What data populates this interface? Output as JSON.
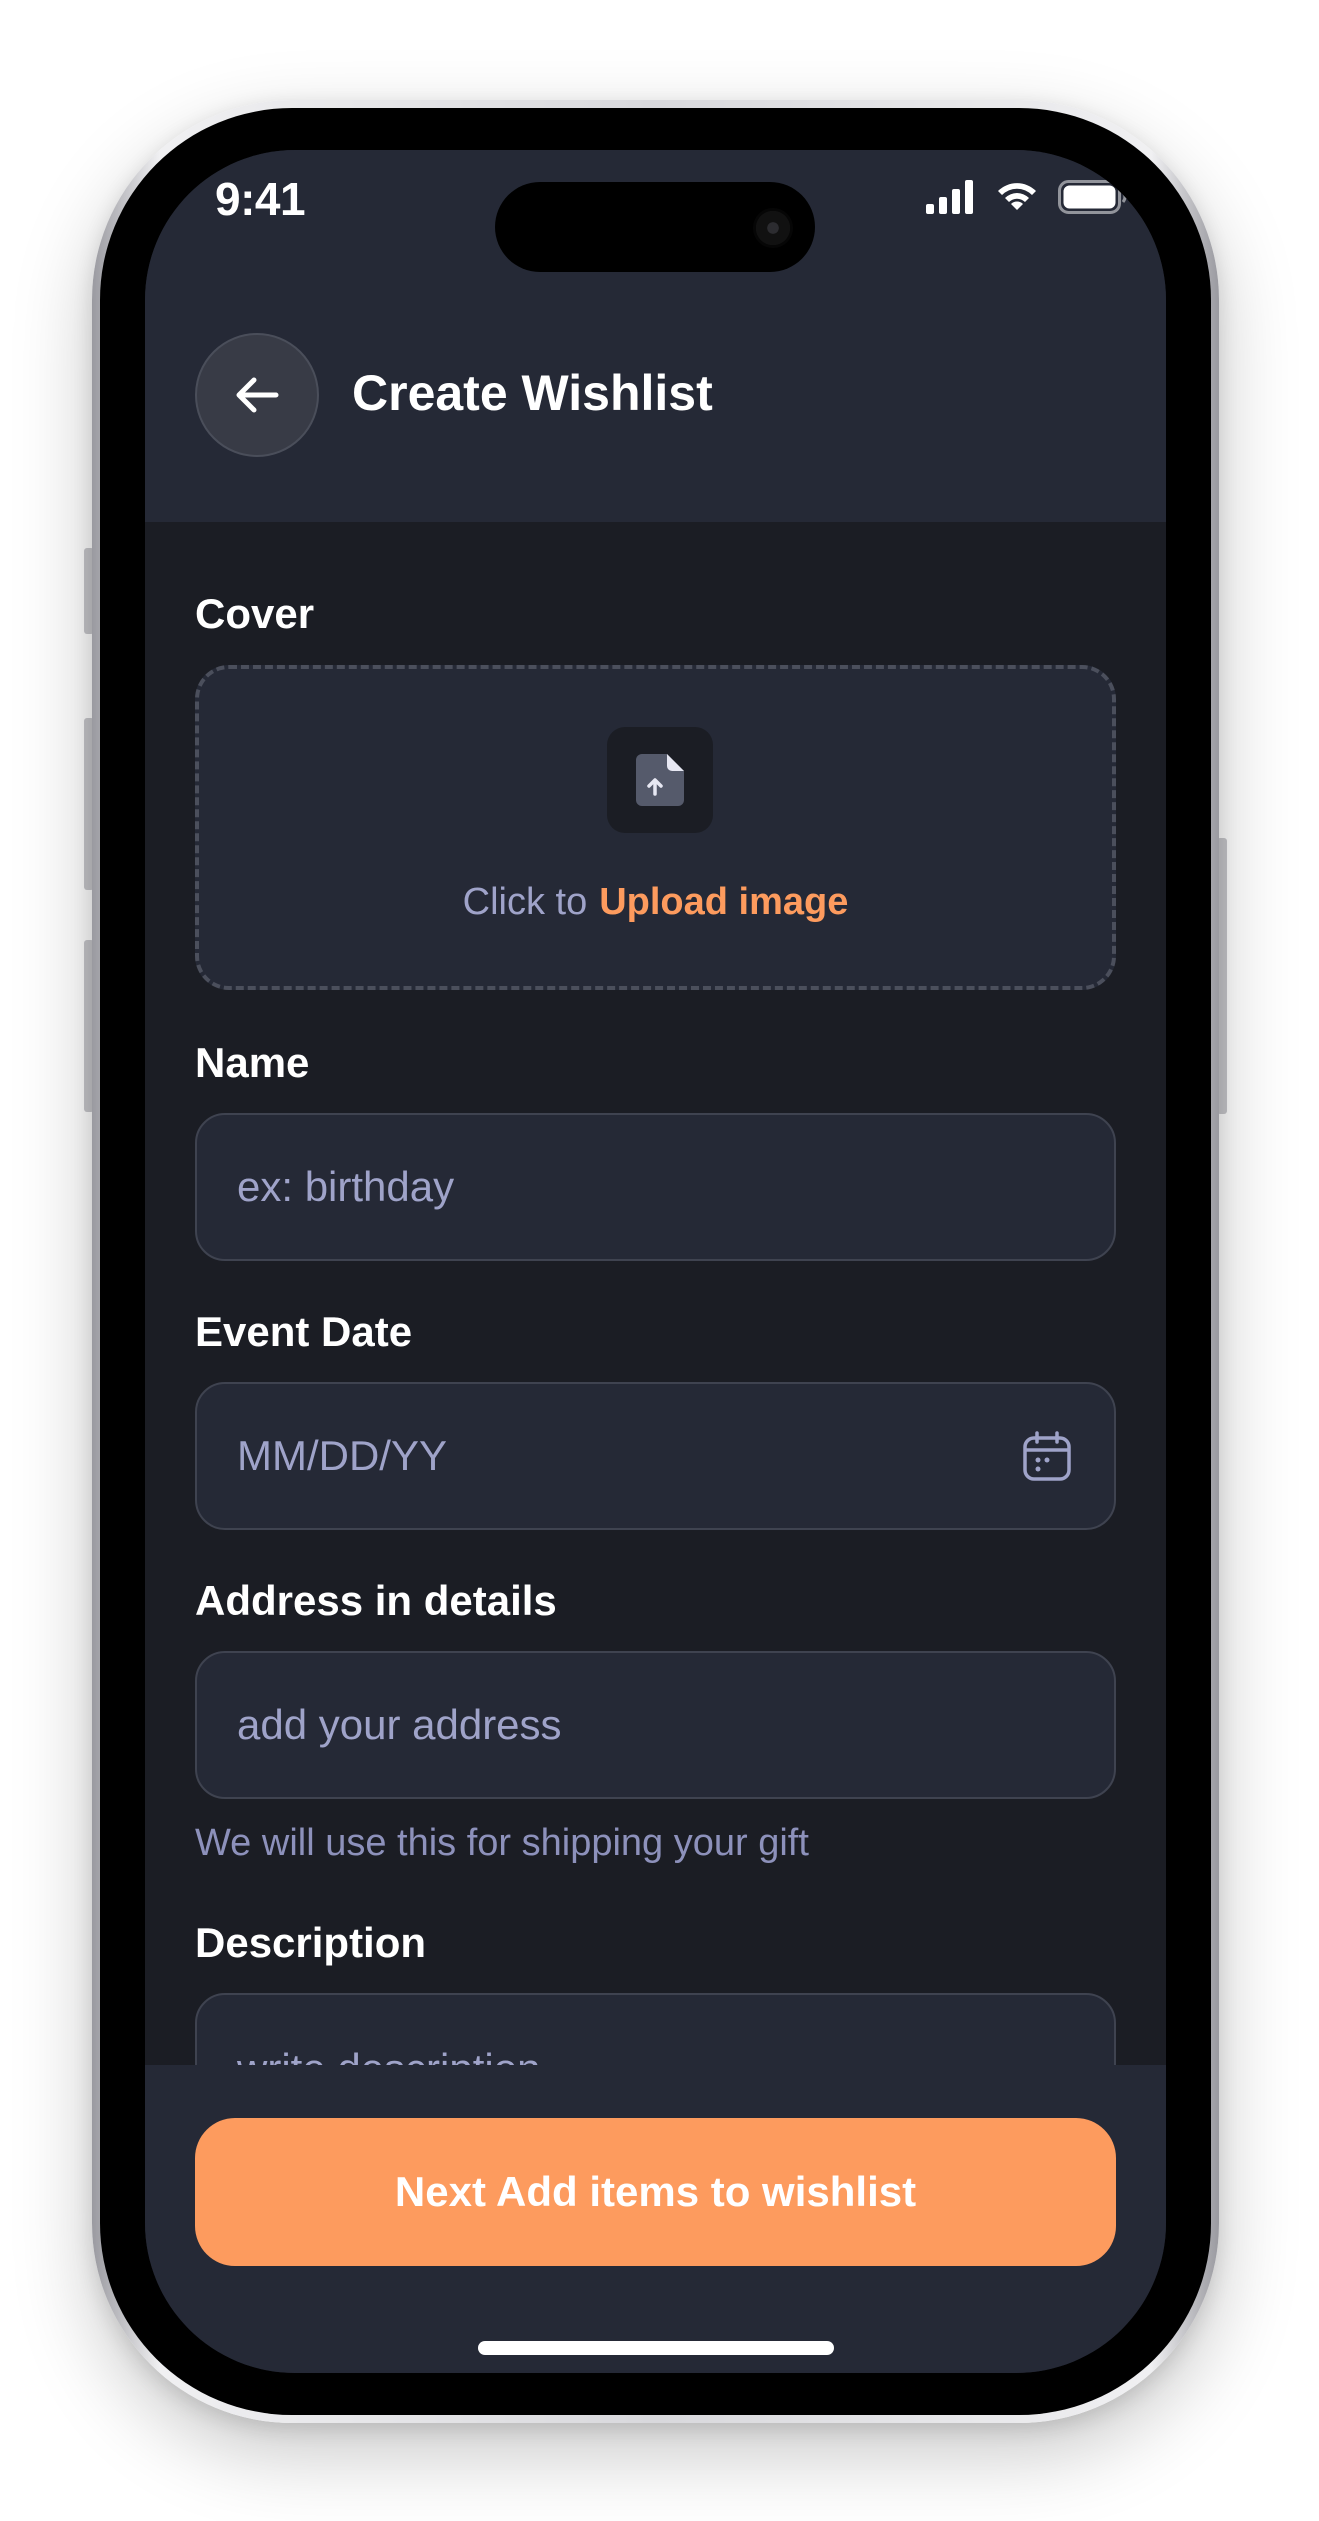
{
  "status_bar": {
    "time": "9:41",
    "icons": [
      "signal-icon",
      "wifi-icon",
      "battery-icon"
    ]
  },
  "header": {
    "back_icon": "arrow-left-icon",
    "title": "Create Wishlist"
  },
  "cover": {
    "label": "Cover",
    "icon": "file-upload-icon",
    "prefix_text": "Click to",
    "action_text": "Upload image"
  },
  "name": {
    "label": "Name",
    "placeholder": "ex: birthday"
  },
  "event_date": {
    "label": "Event Date",
    "placeholder": "MM/DD/YY",
    "icon": "calendar-icon"
  },
  "address": {
    "label": "Address in details",
    "placeholder": "add your address",
    "helper": "We will use this for shipping your gift"
  },
  "description": {
    "label": "Description",
    "placeholder": "write description"
  },
  "cta": {
    "label": "Next Add items to wishlist"
  },
  "colors": {
    "background": "#1b1d24",
    "surface": "#252936",
    "accent": "#fd9b5e",
    "muted_text": "#9fa3c9"
  }
}
